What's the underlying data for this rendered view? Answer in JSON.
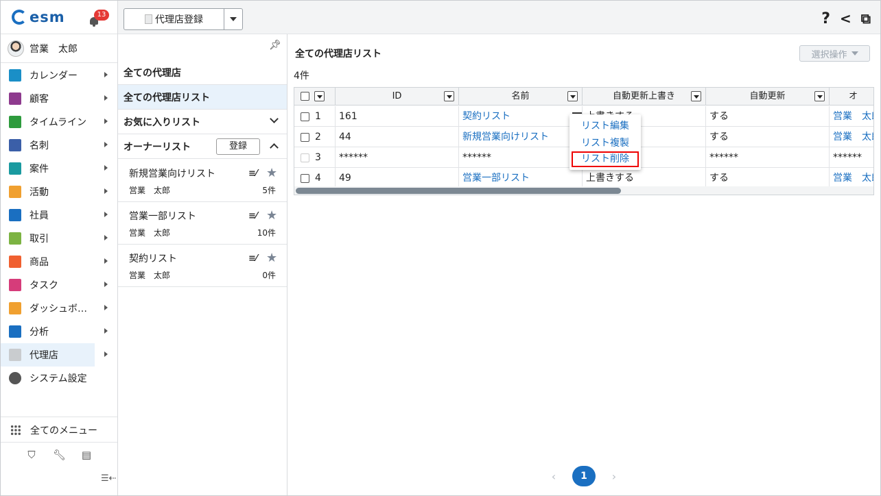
{
  "app": {
    "brand": "esm",
    "notification_count": "13",
    "user_name": "営業　太郎"
  },
  "nav": [
    {
      "label": "カレンダー",
      "icon": "calendar-icon",
      "color": "#1a8fc7"
    },
    {
      "label": "顧客",
      "icon": "building-icon",
      "color": "#8e3a8e"
    },
    {
      "label": "タイムライン",
      "icon": "chat-icon",
      "color": "#2e9b3d"
    },
    {
      "label": "名刺",
      "icon": "business-card-icon",
      "color": "#3b5fa8"
    },
    {
      "label": "案件",
      "icon": "folder-icon",
      "color": "#1a9aa0"
    },
    {
      "label": "活動",
      "icon": "clipboard-icon",
      "color": "#f0a030"
    },
    {
      "label": "社員",
      "icon": "person-icon",
      "color": "#1a6fc1"
    },
    {
      "label": "取引",
      "icon": "ledger-icon",
      "color": "#7cb342"
    },
    {
      "label": "商品",
      "icon": "box-icon",
      "color": "#f06030"
    },
    {
      "label": "タスク",
      "icon": "task-check-icon",
      "color": "#d63c7a"
    },
    {
      "label": "ダッシュボ…",
      "icon": "dashboard-icon",
      "color": "#f0a030"
    },
    {
      "label": "分析",
      "icon": "chart-icon",
      "color": "#1a6fc1"
    },
    {
      "label": "代理店",
      "icon": "document-icon",
      "color": "#c9cccf"
    },
    {
      "label": "システム設定",
      "icon": "gear-icon",
      "color": "#555555"
    }
  ],
  "all_menu_label": "全てのメニュー",
  "topbar": {
    "register_label": "代理店登録"
  },
  "list_panel": {
    "all_label": "全ての代理店",
    "all_list_label": "全ての代理店リスト",
    "favorites_label": "お気に入りリスト",
    "owner_label": "オーナーリスト",
    "register_button": "登録",
    "cards": [
      {
        "title": "新規営業向けリスト",
        "owner": "営業　太郎",
        "count": "5件"
      },
      {
        "title": "営業一部リスト",
        "owner": "営業　太郎",
        "count": "10件"
      },
      {
        "title": "契約リスト",
        "owner": "営業　太郎",
        "count": "0件"
      }
    ]
  },
  "main": {
    "title": "全ての代理店リスト",
    "count": "4件",
    "select_op": "選択操作",
    "columns": [
      "ID",
      "名前",
      "自動更新上書き",
      "自動更新",
      "オ"
    ],
    "rows": [
      {
        "no": "1",
        "id": "161",
        "name": "契約リスト",
        "override": "上書きする",
        "auto": "する",
        "owner": "営業　太郎"
      },
      {
        "no": "2",
        "id": "44",
        "name": "新規営業向けリスト",
        "override": "",
        "auto": "する",
        "owner": "営業　太郎"
      },
      {
        "no": "3",
        "id": "******",
        "name": "******",
        "override": "",
        "auto": "******",
        "owner": "******"
      },
      {
        "no": "4",
        "id": "49",
        "name": "営業一部リスト",
        "override": "上書きする",
        "auto": "する",
        "owner": "営業　太郎"
      }
    ],
    "context_menu": [
      "リスト編集",
      "リスト複製",
      "リスト削除"
    ],
    "page": "1"
  },
  "colors": {
    "accent": "#1a6fc1",
    "highlight_border": "#e00000",
    "badge": "#e53935"
  }
}
